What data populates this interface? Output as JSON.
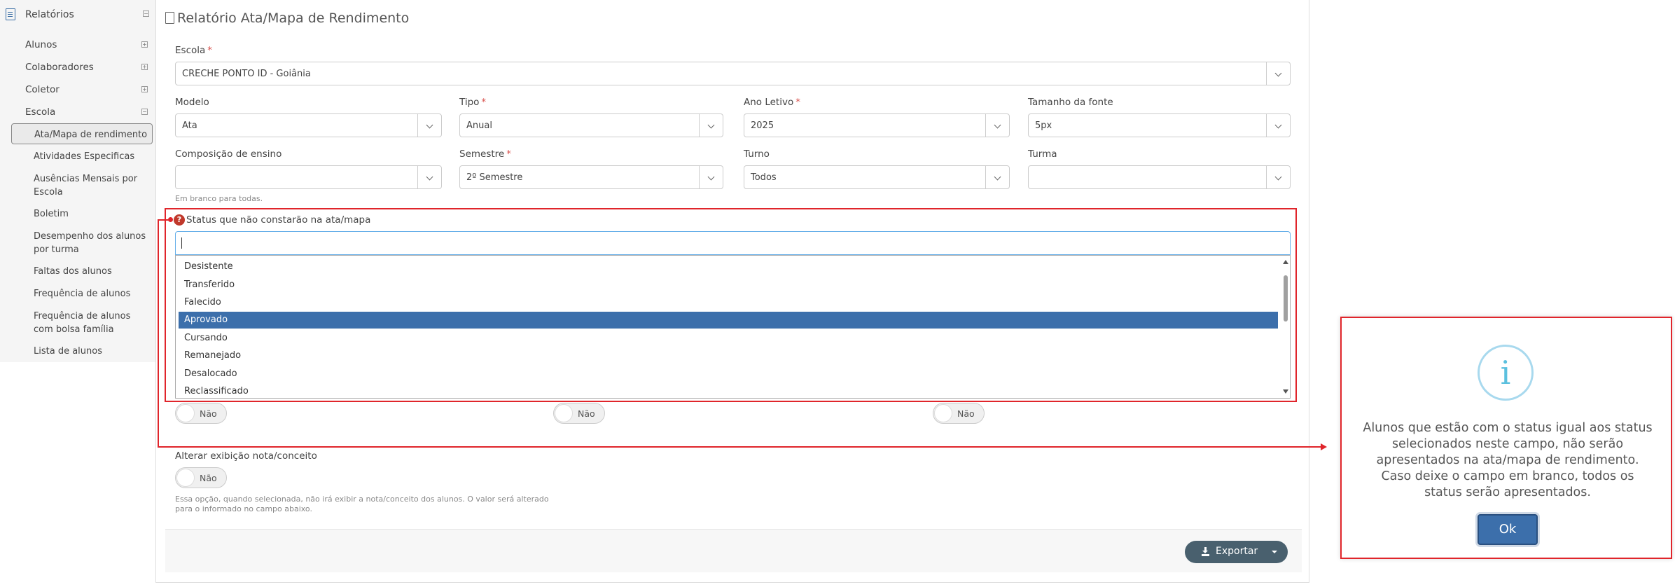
{
  "sidebar": {
    "header": "Relatórios",
    "items": [
      {
        "label": "Alunos"
      },
      {
        "label": "Colaboradores"
      },
      {
        "label": "Coletor"
      },
      {
        "label": "Escola"
      }
    ],
    "subitems": [
      {
        "label": "Ata/Mapa de rendimento"
      },
      {
        "label": "Atividades Especificas"
      },
      {
        "label": "Ausências Mensais por Escola"
      },
      {
        "label": "Boletim"
      },
      {
        "label": "Desempenho dos alunos por turma"
      },
      {
        "label": "Faltas dos alunos"
      },
      {
        "label": "Frequência de alunos"
      },
      {
        "label": "Frequência de alunos com bolsa família"
      },
      {
        "label": "Lista de alunos"
      }
    ]
  },
  "page": {
    "title": "Relatório Ata/Mapa de Rendimento"
  },
  "form": {
    "escola": {
      "label": "Escola",
      "value": "CRECHE PONTO ID - Goiânia"
    },
    "modelo": {
      "label": "Modelo",
      "value": "Ata"
    },
    "tipo": {
      "label": "Tipo",
      "value": "Anual"
    },
    "ano_letivo": {
      "label": "Ano Letivo",
      "value": "2025"
    },
    "tamanho_fonte": {
      "label": "Tamanho da fonte",
      "value": "5px"
    },
    "composicao": {
      "label": "Composição de ensino",
      "value": "",
      "hint": "Em branco para todas."
    },
    "semestre": {
      "label": "Semestre",
      "value": "2º Semestre"
    },
    "turno": {
      "label": "Turno",
      "value": "Todos"
    },
    "turma": {
      "label": "Turma",
      "value": ""
    },
    "required_mark": "*",
    "status": {
      "label": "Status que não constarão na ata/mapa",
      "help_glyph": "?",
      "options": [
        "Desistente",
        "Transferido",
        "Falecido",
        "Aprovado",
        "Cursando",
        "Remanejado",
        "Desalocado",
        "Reclassificado"
      ],
      "highlighted": "Aprovado"
    },
    "toggles": [
      "Não",
      "Não",
      "Não"
    ],
    "alterar": {
      "label": "Alterar exibição nota/conceito",
      "value": "Não",
      "hint_line1": "Essa opção, quando selecionada, não irá exibir a nota/conceito dos alunos. O valor será alterado",
      "hint_line2": "para o informado no campo abaixo."
    }
  },
  "footer": {
    "export_label": "Exportar"
  },
  "modal": {
    "icon": "i",
    "text": "Alunos que estão com o status igual aos status selecionados neste campo, não serão apresentados na ata/mapa de rendimento. Caso deixe o campo em branco, todos os status serão apresentados.",
    "ok_label": "Ok"
  },
  "colors": {
    "accent": "#3c6fab",
    "annotation": "#e0252b",
    "export": "#49606e",
    "info": "#5bc0de"
  }
}
